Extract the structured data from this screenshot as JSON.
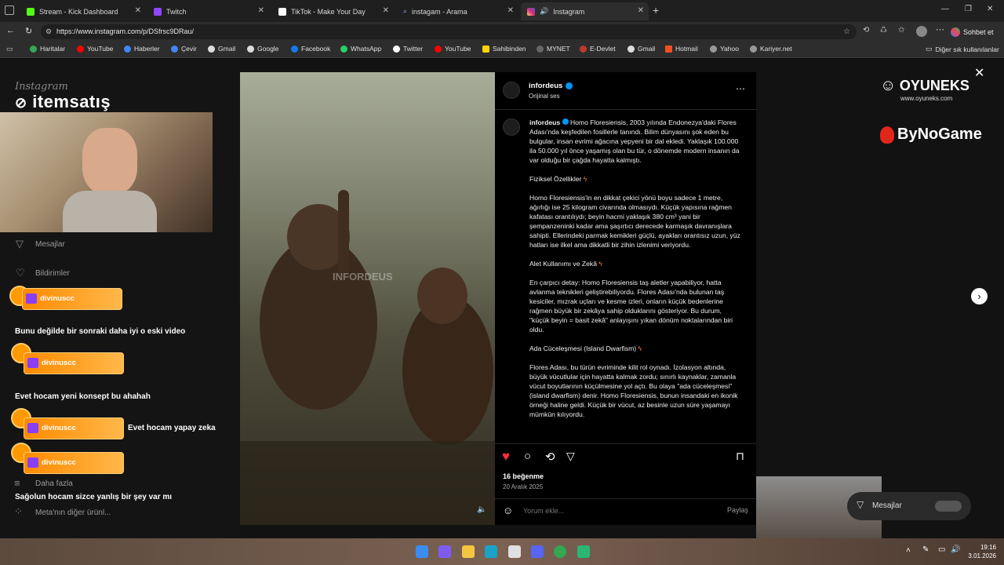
{
  "tabs": [
    {
      "label": "Stream - Kick Dashboard",
      "color": "#53fc18"
    },
    {
      "label": "Twitch",
      "color": "#9146ff"
    },
    {
      "label": "TikTok - Make Your Day",
      "color": "#ffffff"
    },
    {
      "label": "instagam - Arama",
      "color": "#8ab4f8"
    },
    {
      "label": "Instagram",
      "color": "#e1306c"
    }
  ],
  "address": {
    "url": "https://www.instagram.com/p/DSfrsc9DRau/",
    "chat_label": "Sohbet et"
  },
  "bookmarks": [
    "Haritalar",
    "YouTube",
    "Haberler",
    "Çevir",
    "Gmail",
    "Google",
    "Facebook",
    "WhatsApp",
    "Twitter",
    "YouTube",
    "Sahibinden",
    "MYNET",
    "E-Devlet",
    "Gmail",
    "Hotmail",
    "Yahoo",
    "Kariyer.net"
  ],
  "bookmarks_other": "Diğer sık kullanılanlar",
  "left": {
    "logo_small": "Instagram",
    "logo_brand": "itemsatış",
    "nav": {
      "messages": "Mesajlar",
      "notifications": "Bildirimler",
      "more": "Daha fazla",
      "meta": "Meta'nın diğer ürünl..."
    },
    "chat": [
      {
        "user": "divinuscc",
        "message": "Bunu değilde bir sonraki daha iyi o eski video"
      },
      {
        "user": "divinuscc",
        "message": "Evet hocam yeni konsept bu ahahah"
      },
      {
        "user": "divinuscc",
        "message": "Evet hocam yapay zeka"
      },
      {
        "user": "divinuscc",
        "message": "Sağolun hocam sizce yanlış bir şey var mı"
      }
    ]
  },
  "video": {
    "watermark": "INFORDEUS"
  },
  "post": {
    "username": "infordeus",
    "audio": "Orijinal ses",
    "caption_intro": "Homo Floresiensis, 2003 yılında Endonezya'daki Flores Adası'nda keşfedilen fosillerle tanındı. Bilim dünyasını şok eden bu bulgular, insan evrimi ağacına yepyeni bir dal ekledi. Yaklaşık 100.000 ila 50.000 yıl önce yaşamış olan bu tür, o dönemde modern insanın da var olduğu bir çağda hayatta kalmıştı.",
    "h1": "Fiziksel Özellikler",
    "p1": "Homo Floresiensis'in en dikkat çekici yönü boyu sadece 1 metre, ağırlığı ise 25 kilogram civarında olmasıydı. Küçük yapısına rağmen kafatası orantılıydı; beyin hacmi yaklaşık 380 cm³ yani bir şempanzeninki kadar ama şaşırtıcı derecede karmaşık davranışlara sahipti. Ellerindeki parmak kemikleri güçlü, ayakları orantısız uzun, yüz hatları ise ilkel ama dikkatli bir zihin izlenimi veriyordu.",
    "h2": "Alet Kullanımı ve Zekâ",
    "p2": "En çarpıcı detay: Homo Floresiensis taş aletler yapabiliyor, hatta avlanma teknikleri geliştirebiliyordu. Flores Adası'nda bulunan taş kesiciler, mızrak uçları ve kesme izleri, onların küçük bedenlerine rağmen büyük bir zekâya sahip olduklarını gösteriyor. Bu durum, \"küçük beyin = basit zekâ\" anlayışını yıkan dönüm noktalarından biri oldu.",
    "h3": "Ada Cüceleşmesi (Island Dwarfism)",
    "p3": "Flores Adası, bu türün evriminde kilit rol oynadı. İzolasyon altında, büyük vücutlular için hayatta kalmak zordu; sınırlı kaynaklar, zamanla vücut boyutlarının küçülmesine yol açtı. Bu olaya \"ada cüceleşmesi\" (island dwarfism) denir. Homo Floresiensis, bunun insandaki en ikonik örneği haline geldi. Küçük bir vücut, az besinle uzun süre yaşamayı mümkün kılıyordu.",
    "likes": "16 beğenme",
    "date": "20 Aralık 2025",
    "comment_placeholder": "Yorum ekle...",
    "share": "Paylaş"
  },
  "right": {
    "sponsor1": "OYUNEKS",
    "sponsor1_url": "www.oyuneks.com",
    "sponsor2": "ByNoGame",
    "messages": "Mesajlar"
  },
  "taskbar": {
    "time": "19:16",
    "date": "3.01.2026"
  },
  "colors": {
    "like": "#ff3040",
    "verified": "#0095f6",
    "accent": "#ff9900"
  }
}
